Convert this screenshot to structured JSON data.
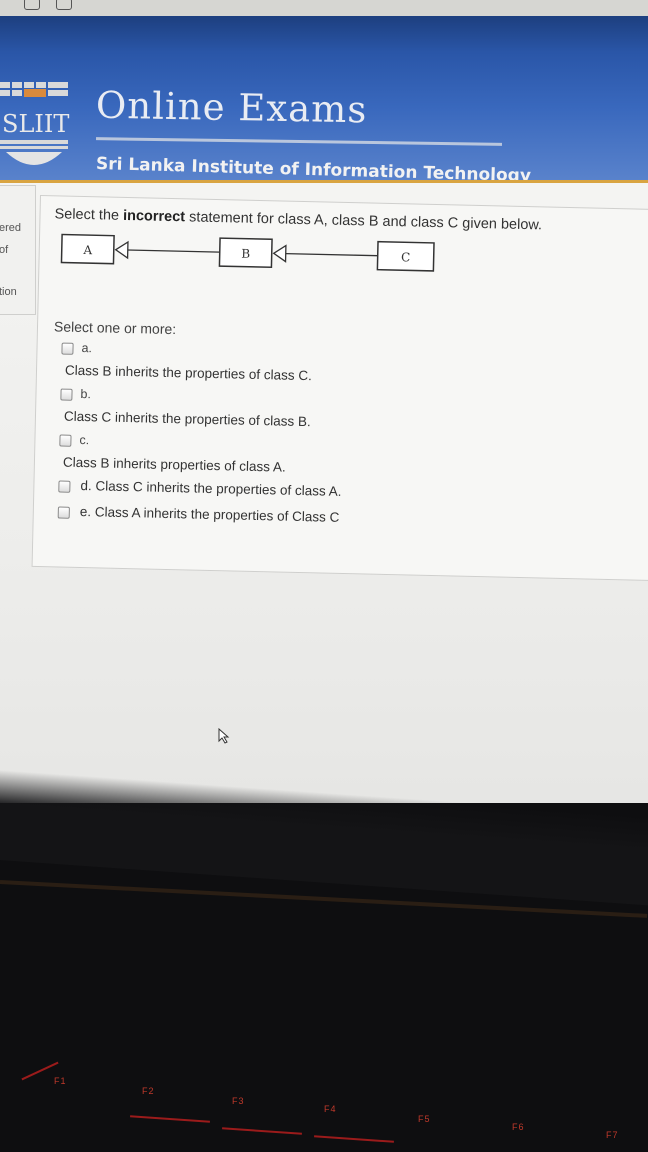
{
  "header": {
    "title": "Online Exams",
    "subtitle": "Sri Lanka Institute of Information Technology",
    "logo_text": "SLIIT"
  },
  "sidebar": {
    "line1": "ered",
    "line2": "of",
    "line3": "tion"
  },
  "question": {
    "text_before": "Select the ",
    "text_bold": "incorrect",
    "text_after": " statement for class A, class B and class C given below.",
    "classes": [
      "A",
      "B",
      "C"
    ],
    "instruction": "Select one or more:",
    "options": [
      {
        "letter": "a.",
        "text": "Class B inherits the properties of class C."
      },
      {
        "letter": "b.",
        "text": "Class C inherits the properties of class B."
      },
      {
        "letter": "c.",
        "text": "Class B inherits properties of class A."
      },
      {
        "letter": "d.",
        "text": "Class C inherits the properties of class A."
      },
      {
        "letter": "e.",
        "text": "Class A inherits the properties of Class C"
      }
    ]
  },
  "keyboard": {
    "keys": [
      "F1",
      "F2",
      "F3",
      "F4",
      "F5",
      "F6",
      "F7"
    ]
  },
  "colors": {
    "header_blue": "#3968bd",
    "accent_orange": "#d9a441",
    "key_red": "#c0392b"
  }
}
